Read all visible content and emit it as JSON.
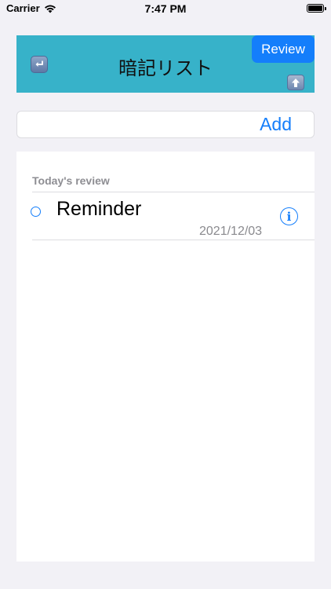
{
  "status_bar": {
    "carrier": "Carrier",
    "time": "7:47 PM"
  },
  "header": {
    "title": "暗記リスト",
    "review_label": "Review",
    "back_icon": "return-arrow-icon",
    "up_icon": "up-arrow-icon"
  },
  "add_bar": {
    "input_value": "",
    "button_label": "Add"
  },
  "list": {
    "section_title": "Today's review",
    "items": [
      {
        "title": "Reminder",
        "date": "2021/12/03"
      }
    ]
  },
  "colors": {
    "header_bg": "#37b2c9",
    "accent": "#147efb",
    "background": "#f2f1f6"
  }
}
